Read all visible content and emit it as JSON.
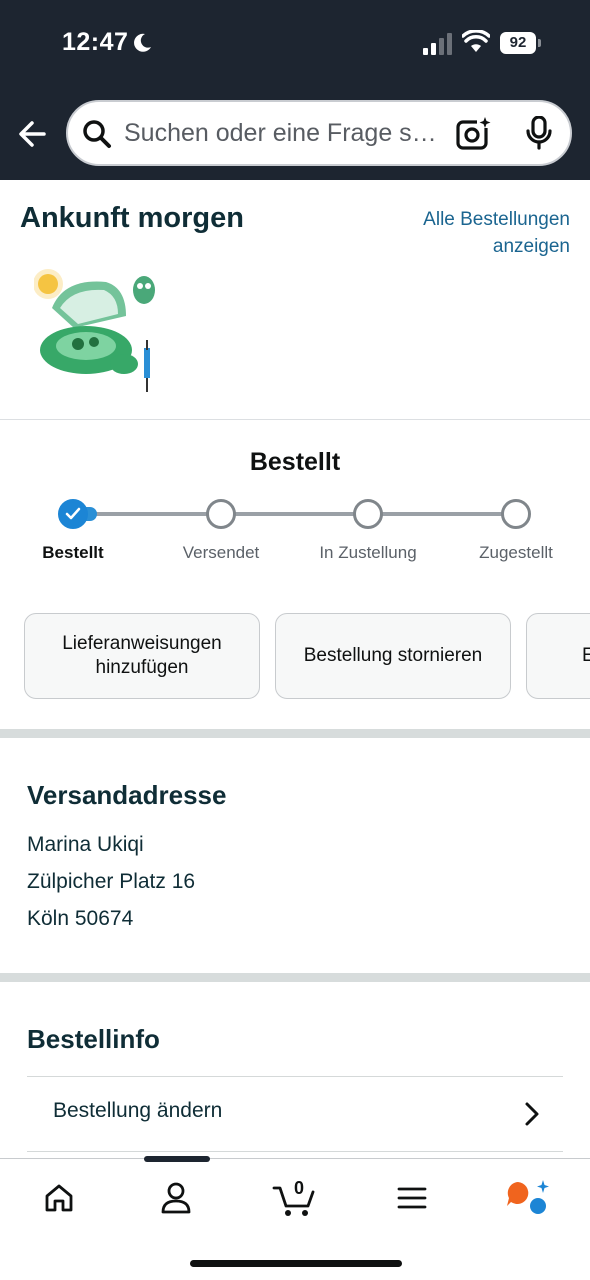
{
  "status": {
    "time": "12:47",
    "battery": "92"
  },
  "search": {
    "placeholder": "Suchen oder eine Frage s…"
  },
  "arrival": {
    "title": "Ankunft morgen",
    "all_orders_line1": "Alle Bestellungen",
    "all_orders_line2": "anzeigen"
  },
  "progress": {
    "title": "Bestellt",
    "steps": [
      "Bestellt",
      "Versendet",
      "In Zustellung",
      "Zugestellt"
    ],
    "current_step": 1
  },
  "actions": {
    "delivery_instructions_line1": "Lieferanweisungen",
    "delivery_instructions_line2": "hinzufügen",
    "cancel_order": "Bestellung stornieren",
    "third_partial": "E"
  },
  "shipping": {
    "title": "Versandadresse",
    "name": "Marina Ukiqi",
    "street": "Zülpicher Platz 16",
    "city": "Köln 50674"
  },
  "order_info": {
    "title": "Bestellinfo",
    "change_order": "Bestellung ändern"
  },
  "nav": {
    "cart_count": "0"
  },
  "colors": {
    "header_bg": "#1d2530",
    "link": "#1b6590",
    "progress_active": "#1c85d5",
    "rufus_orange": "#f0641e",
    "rufus_blue": "#1c85d5"
  }
}
